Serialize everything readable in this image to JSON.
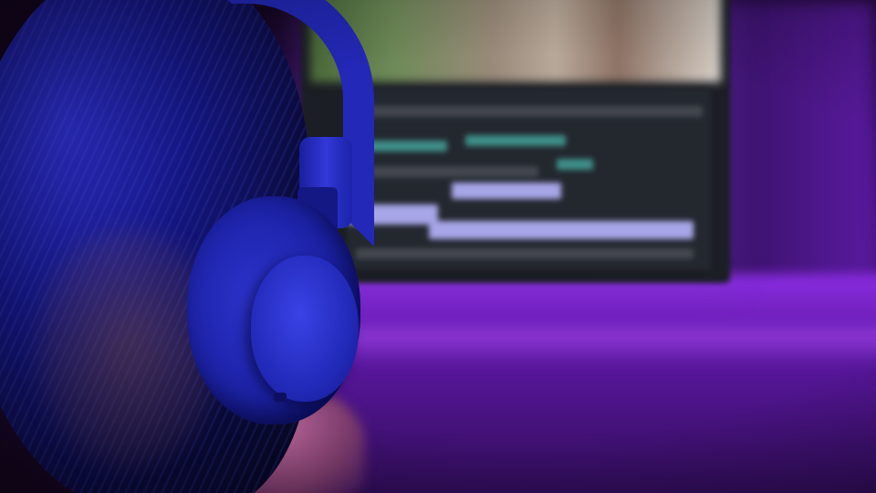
{
  "scene": {
    "colors": {
      "headphones": "#2328b8",
      "ambient_light": "#6d1fb0",
      "hair_highlight": "#2a2cc0",
      "timeline_clip_teal": "#3f8f8a",
      "timeline_clip_lavender": "#a7a6e8",
      "screen_panel": "#23272e"
    },
    "elements": [
      "person-head",
      "over-ear-headphones",
      "monitor",
      "video-editing-timeline",
      "desk"
    ]
  }
}
